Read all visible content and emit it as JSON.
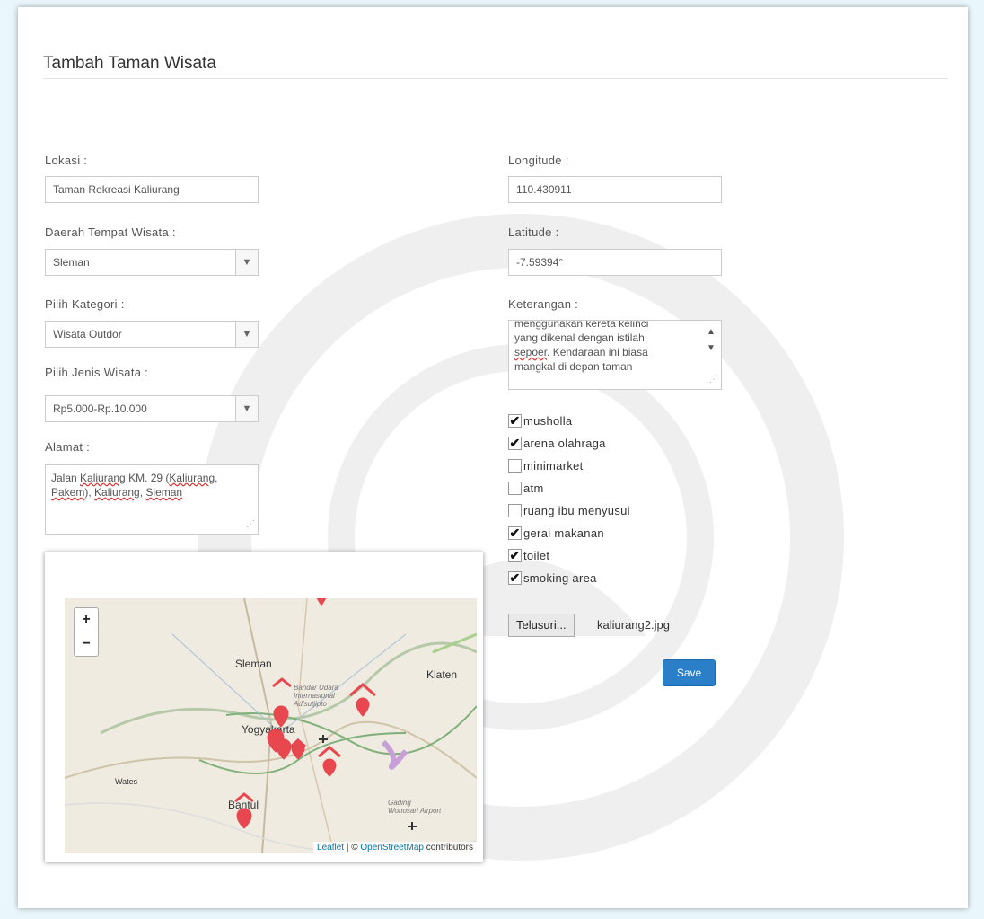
{
  "page": {
    "title": "Tambah Taman Wisata"
  },
  "form": {
    "lokasi_label": "Lokasi :",
    "lokasi_value": "Taman Rekreasi Kaliurang",
    "daerah_label": "Daerah Tempat Wisata :",
    "daerah_value": "Sleman",
    "kategori_label": "Pilih Kategori :",
    "kategori_value": "Wisata Outdor",
    "jenis_label": "Pilih Jenis Wisata :",
    "jenis_value": "Rp5.000-Rp.10.000",
    "alamat_label": "Alamat :",
    "alamat_parts": [
      "Jalan ",
      "Kaliurang",
      " KM. 29 (",
      "Kaliurang",
      ", ",
      "Pakem",
      "), ",
      "Kaliurang",
      ", ",
      "Sleman"
    ],
    "longitude_label": "Longitude :",
    "longitude_value": "110.430911",
    "latitude_label": "Latitude :",
    "latitude_value": "-7.59394°",
    "keterangan_label": "Keterangan :",
    "keterangan_lines": [
      "menggunakan kereta kelinci",
      "yang dikenal dengan istilah",
      "sepoer",
      ". Kendaraan ini biasa",
      "mangkal di depan taman"
    ]
  },
  "facilities": [
    {
      "label": "musholla",
      "checked": true
    },
    {
      "label": "arena olahraga",
      "checked": true
    },
    {
      "label": "minimarket",
      "checked": false
    },
    {
      "label": "atm",
      "checked": false
    },
    {
      "label": "ruang ibu menyusui",
      "checked": false
    },
    {
      "label": "gerai makanan",
      "checked": true
    },
    {
      "label": "toilet",
      "checked": true
    },
    {
      "label": "smoking area",
      "checked": true
    }
  ],
  "file": {
    "button_label": "Telusuri...",
    "filename": "kaliurang2.jpg"
  },
  "save_label": "Save",
  "map": {
    "zoom_in": "+",
    "zoom_out": "−",
    "labels": {
      "sleman": "Sleman",
      "klaten": "Klaten",
      "yogyakarta": "Yogyakarta",
      "bantul": "Bantul",
      "wates": "Wates",
      "airport1": "Bandar Udara Internasional Adisutjipto",
      "airport2": "Gading Wonosari Airport"
    },
    "attribution": {
      "leaflet": "Leaflet",
      "sep": " | © ",
      "osm": "OpenStreetMap",
      "contrib": " contributors"
    },
    "marker_color": "#e8474f"
  }
}
